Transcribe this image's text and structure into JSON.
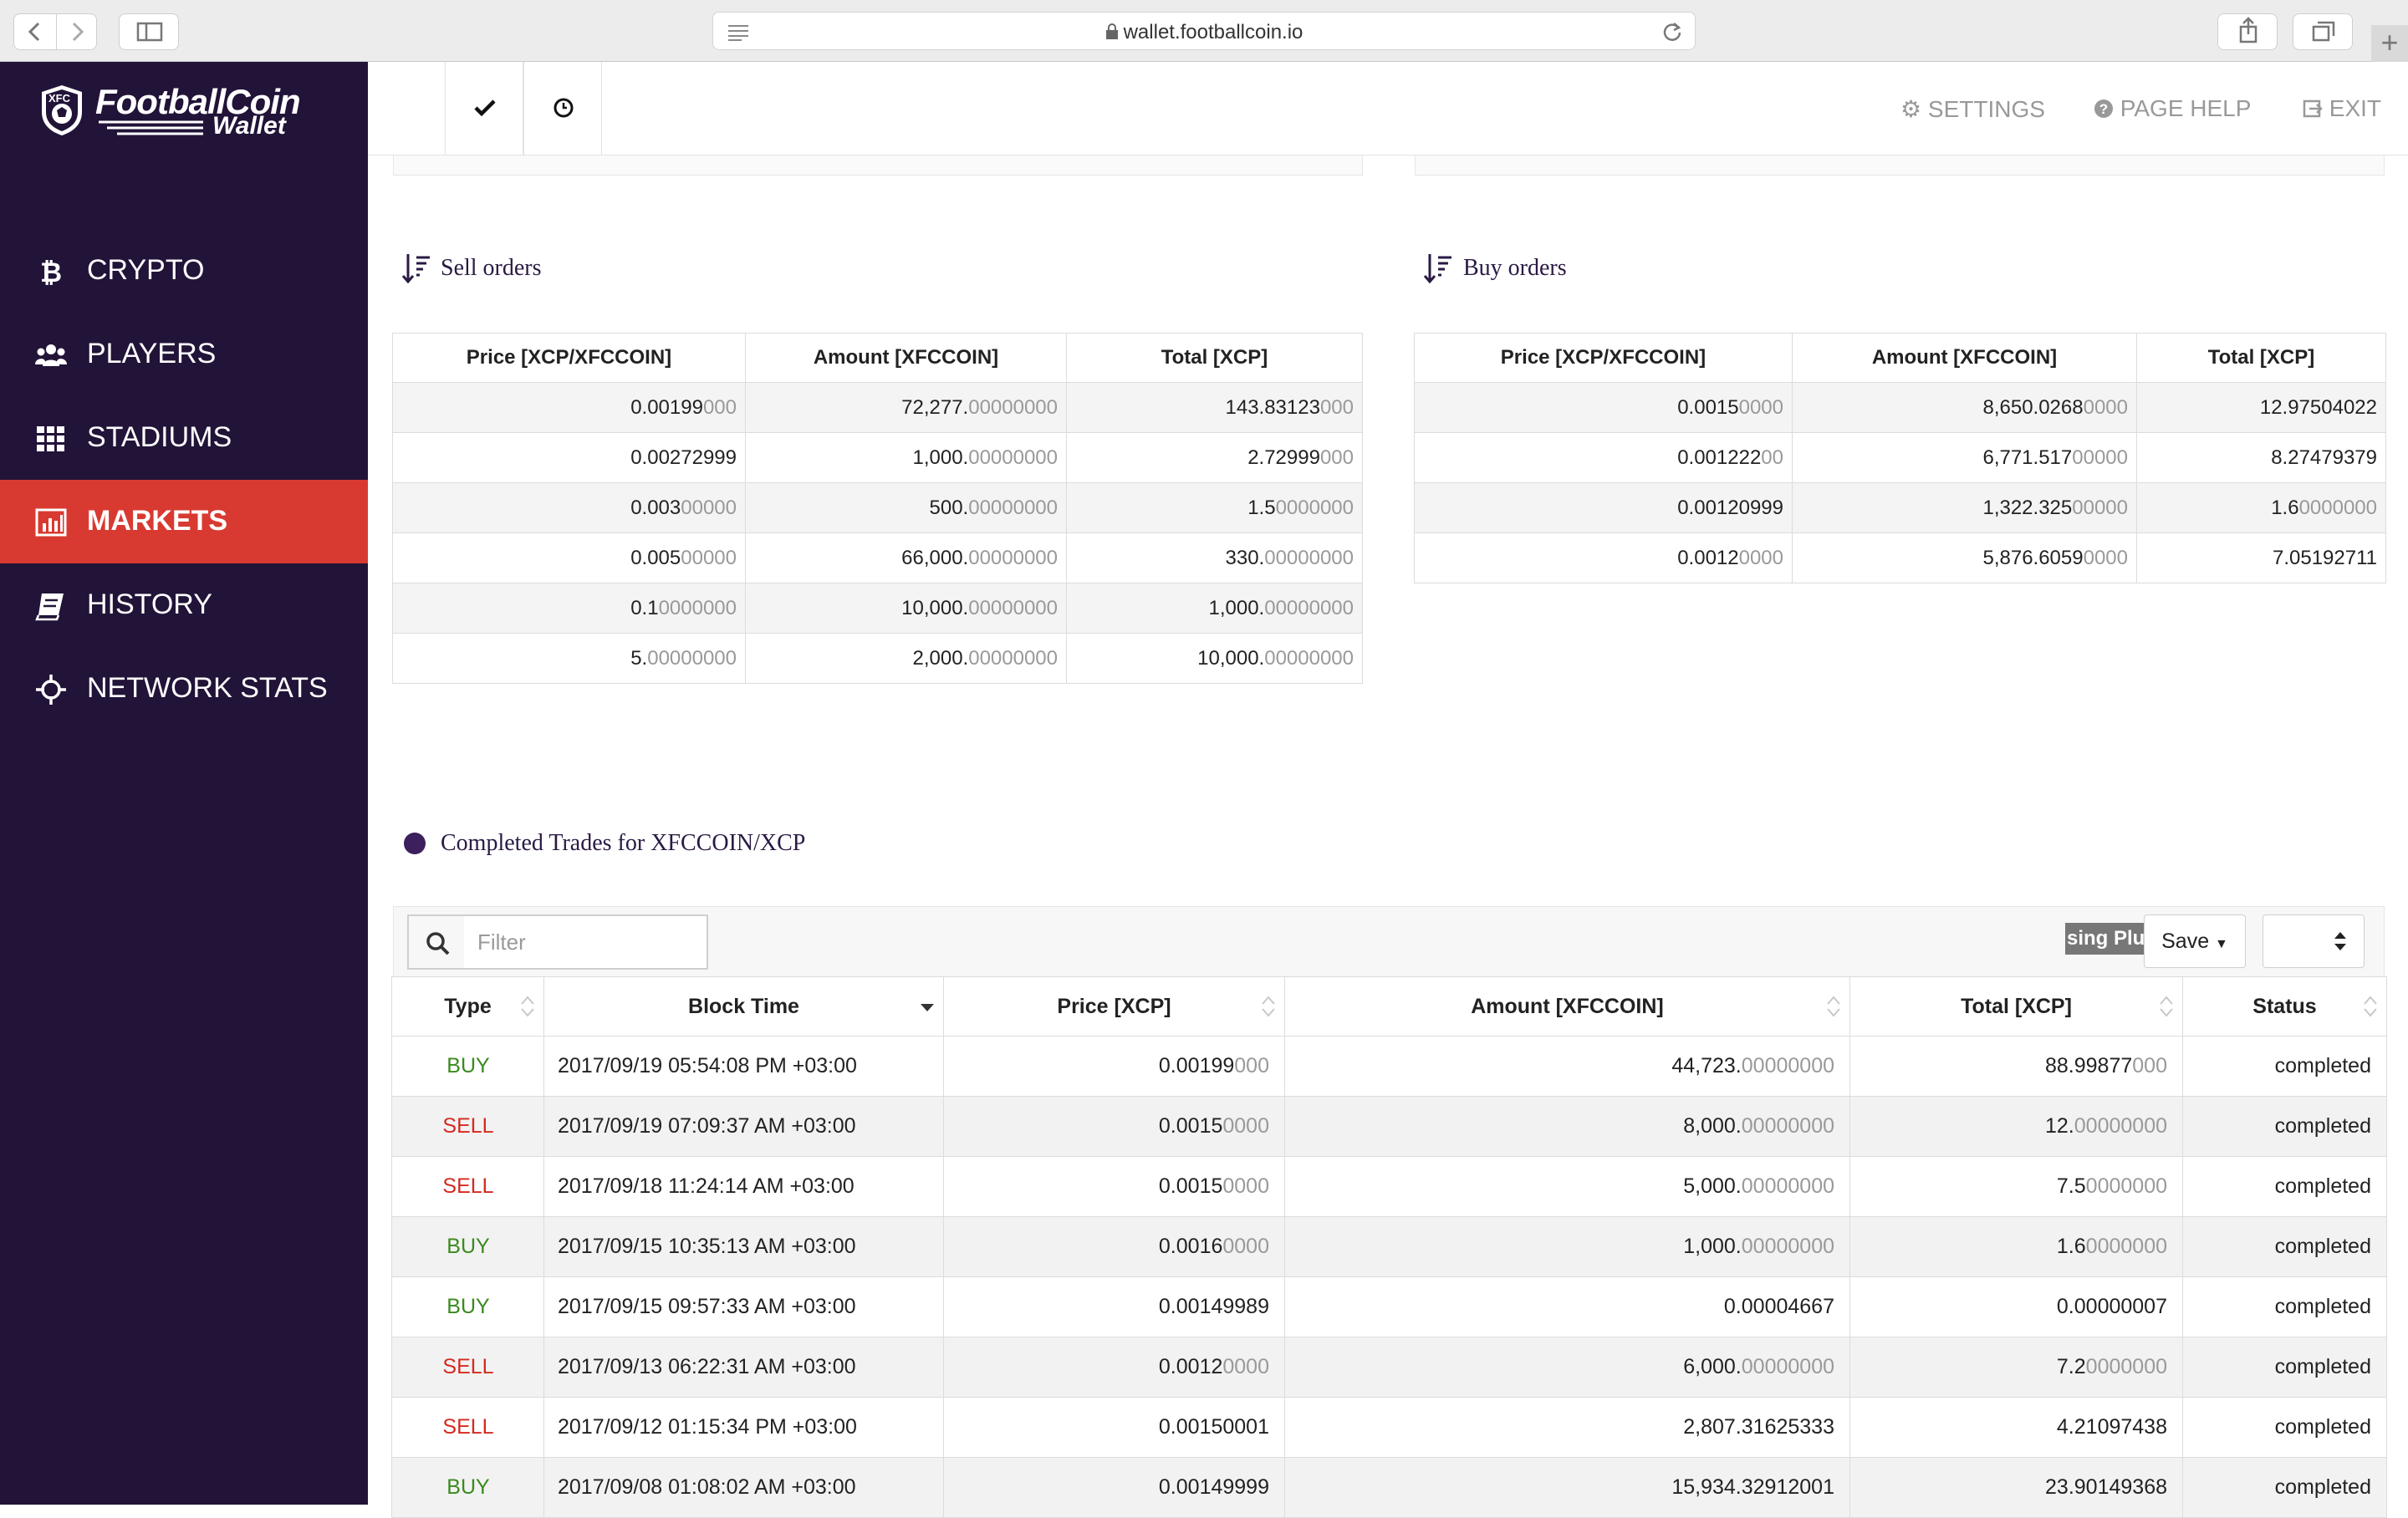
{
  "browser": {
    "url": "wallet.footballcoin.io"
  },
  "brand": {
    "name": "FootballCoin",
    "sub": "Wallet",
    "shield_letters": "XFC"
  },
  "sidebar": {
    "items": [
      {
        "label": "CRYPTO",
        "icon": "bitcoin-icon",
        "active": false
      },
      {
        "label": "PLAYERS",
        "icon": "users-icon",
        "active": false
      },
      {
        "label": "STADIUMS",
        "icon": "grid-icon",
        "active": false
      },
      {
        "label": "MARKETS",
        "icon": "bar-chart-icon",
        "active": true
      },
      {
        "label": "HISTORY",
        "icon": "book-icon",
        "active": false
      },
      {
        "label": "NETWORK STATS",
        "icon": "crosshair-icon",
        "active": false
      }
    ]
  },
  "topbar": {
    "tabs": [
      "check-icon",
      "clock-icon"
    ],
    "settings": "SETTINGS",
    "help": "PAGE HELP",
    "exit": "EXIT"
  },
  "sell_orders": {
    "title": "Sell orders",
    "headers": [
      "Price [XCP/XFCCOIN]",
      "Amount [XFCCOIN]",
      "Total [XCP]"
    ],
    "rows": [
      [
        [
          "0.00199",
          "000"
        ],
        [
          "72,277.",
          "00000000"
        ],
        [
          "143.83123",
          "000"
        ]
      ],
      [
        [
          "0.00272999",
          ""
        ],
        [
          "1,000.",
          "00000000"
        ],
        [
          "2.72999",
          "000"
        ]
      ],
      [
        [
          "0.003",
          "00000"
        ],
        [
          "500.",
          "00000000"
        ],
        [
          "1.5",
          "0000000"
        ]
      ],
      [
        [
          "0.005",
          "00000"
        ],
        [
          "66,000.",
          "00000000"
        ],
        [
          "330.",
          "00000000"
        ]
      ],
      [
        [
          "0.1",
          "0000000"
        ],
        [
          "10,000.",
          "00000000"
        ],
        [
          "1,000.",
          "00000000"
        ]
      ],
      [
        [
          "5.",
          "00000000"
        ],
        [
          "2,000.",
          "00000000"
        ],
        [
          "10,000.",
          "00000000"
        ]
      ]
    ]
  },
  "buy_orders": {
    "title": "Buy orders",
    "headers": [
      "Price [XCP/XFCCOIN]",
      "Amount [XFCCOIN]",
      "Total [XCP]"
    ],
    "rows": [
      [
        [
          "0.0015",
          "0000"
        ],
        [
          "8,650.0268",
          "0000"
        ],
        [
          "12.97504022",
          ""
        ]
      ],
      [
        [
          "0.001222",
          "00"
        ],
        [
          "6,771.517",
          "00000"
        ],
        [
          "8.27479379",
          ""
        ]
      ],
      [
        [
          "0.00120999",
          ""
        ],
        [
          "1,322.325",
          "00000"
        ],
        [
          "1.6",
          "0000000"
        ]
      ],
      [
        [
          "0.0012",
          "0000"
        ],
        [
          "5,876.6059",
          "0000"
        ],
        [
          "7.05192711",
          ""
        ]
      ]
    ]
  },
  "trades": {
    "title": "Completed Trades for XFCCOIN/XCP",
    "filter_placeholder": "Filter",
    "columns_chip": "sing Plu",
    "save_label": "Save",
    "headers": [
      "Type",
      "Block Time",
      "Price [XCP]",
      "Amount [XFCCOIN]",
      "Total [XCP]",
      "Status"
    ],
    "rows": [
      {
        "type": "BUY",
        "time": "2017/09/19 05:54:08 PM +03:00",
        "price": [
          "0.00199",
          "000"
        ],
        "amount": [
          "44,723.",
          "00000000"
        ],
        "total": [
          "88.99877",
          "000"
        ],
        "status": "completed"
      },
      {
        "type": "SELL",
        "time": "2017/09/19 07:09:37 AM +03:00",
        "price": [
          "0.0015",
          "0000"
        ],
        "amount": [
          "8,000.",
          "00000000"
        ],
        "total": [
          "12.",
          "00000000"
        ],
        "status": "completed"
      },
      {
        "type": "SELL",
        "time": "2017/09/18 11:24:14 AM +03:00",
        "price": [
          "0.0015",
          "0000"
        ],
        "amount": [
          "5,000.",
          "00000000"
        ],
        "total": [
          "7.5",
          "0000000"
        ],
        "status": "completed"
      },
      {
        "type": "BUY",
        "time": "2017/09/15 10:35:13 AM +03:00",
        "price": [
          "0.0016",
          "0000"
        ],
        "amount": [
          "1,000.",
          "00000000"
        ],
        "total": [
          "1.6",
          "0000000"
        ],
        "status": "completed"
      },
      {
        "type": "BUY",
        "time": "2017/09/15 09:57:33 AM +03:00",
        "price": [
          "0.00149989",
          ""
        ],
        "amount": [
          "0.00004667",
          ""
        ],
        "total": [
          "0.00000007",
          ""
        ],
        "status": "completed"
      },
      {
        "type": "SELL",
        "time": "2017/09/13 06:22:31 AM +03:00",
        "price": [
          "0.0012",
          "0000"
        ],
        "amount": [
          "6,000.",
          "00000000"
        ],
        "total": [
          "7.2",
          "0000000"
        ],
        "status": "completed"
      },
      {
        "type": "SELL",
        "time": "2017/09/12 01:15:34 PM +03:00",
        "price": [
          "0.00150001",
          ""
        ],
        "amount": [
          "2,807.31625333",
          ""
        ],
        "total": [
          "4.21097438",
          ""
        ],
        "status": "completed"
      },
      {
        "type": "BUY",
        "time": "2017/09/08 01:08:02 AM +03:00",
        "price": [
          "0.00149999",
          ""
        ],
        "amount": [
          "15,934.32912001",
          ""
        ],
        "total": [
          "23.90149368",
          ""
        ],
        "status": "completed"
      }
    ]
  },
  "colors": {
    "sidebar_bg": "#221338",
    "active_item": "#d83a31",
    "buy": "#3a8a1f",
    "sell": "#d42a20",
    "title_text": "#2a1a44"
  }
}
